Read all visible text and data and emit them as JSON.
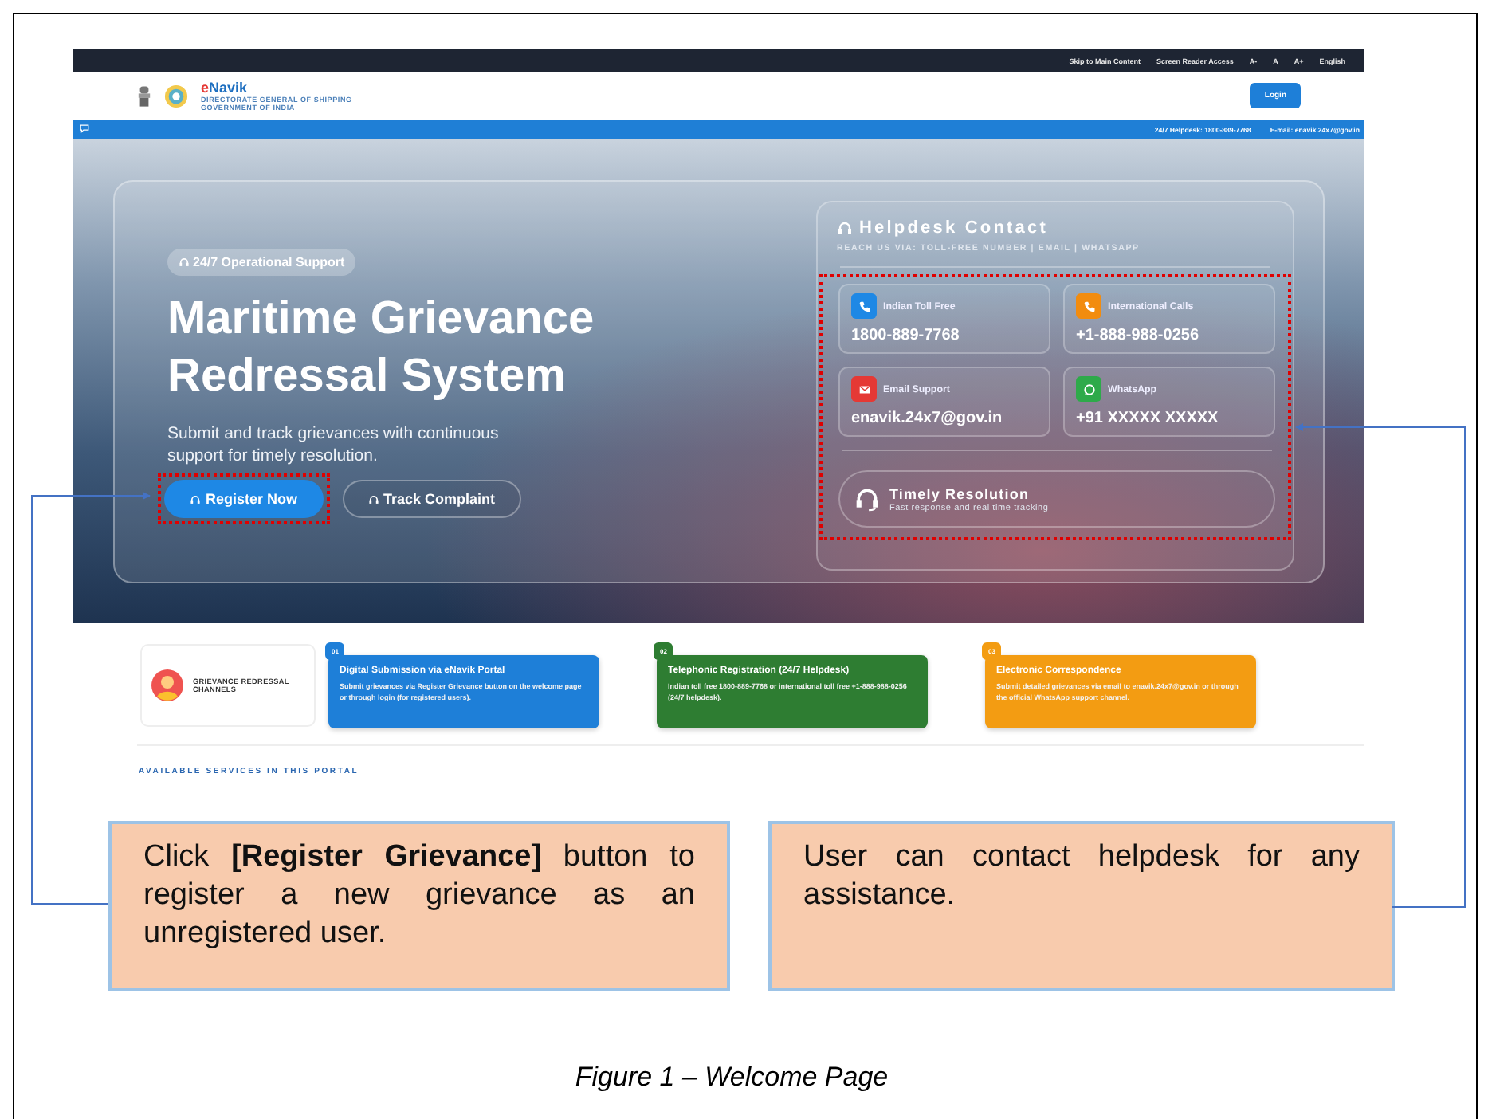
{
  "top_bar": {
    "links": [
      "Skip to Main Content",
      "Screen Reader Access",
      "A-",
      "A",
      "A+",
      "English"
    ]
  },
  "header": {
    "brand_initial": "e",
    "brand_rest": "Navik",
    "subtitle_lines": [
      "DIRECTORATE GENERAL OF SHIPPING",
      "GOVERNMENT OF INDIA"
    ],
    "login": "Login"
  },
  "info_bar": {
    "items": [
      "24/7 Helpdesk: 1800-889-7768",
      "E-mail: enavik.24x7@gov.in"
    ]
  },
  "hero": {
    "badge": "24/7 Operational Support",
    "title_lines": [
      "Maritime Grievance",
      "Redressal System"
    ],
    "description": "Submit and track grievances with continuous support for timely resolution.",
    "buttons": [
      {
        "label": "Register Now",
        "kind": "primary",
        "highlighted": true
      },
      {
        "label": "Track Complaint",
        "kind": "outline",
        "highlighted": false
      }
    ]
  },
  "helpdesk": {
    "title": "Helpdesk Contact",
    "subtitle": "REACH US VIA: TOLL-FREE NUMBER | EMAIL | WHATSAPP",
    "highlighted": true,
    "contacts": [
      {
        "label": "Indian Toll Free",
        "value": "1800-889-7768",
        "kind": "phone",
        "color": "#1e88e5"
      },
      {
        "label": "International Calls",
        "value": "+1-888-988-0256",
        "kind": "phone",
        "color": "#f28c0f"
      },
      {
        "label": "Email Support",
        "value": "enavik.24x7@gov.in",
        "kind": "mail",
        "color": "#e53935"
      },
      {
        "label": "WhatsApp",
        "value": "+91 XXXXX XXXXX",
        "kind": "chat",
        "color": "#2eaa4a"
      }
    ],
    "resolution": {
      "title": "Timely Resolution",
      "subtitle": "Fast response and real time tracking"
    }
  },
  "channels": {
    "heading_lines": [
      "GRIEVANCE REDRESSAL",
      "CHANNELS"
    ],
    "items": [
      {
        "number": "01",
        "title": "Digital Submission via eNavik Portal",
        "text": "Submit grievances via Register Grievance button on the welcome page or through login (for registered users).",
        "color": "#1e7fd8"
      },
      {
        "number": "02",
        "title": "Telephonic Registration (24/7 Helpdesk)",
        "text": "Indian toll free 1800-889-7768 or international toll free +1-888-988-0256 (24/7 helpdesk).",
        "color": "#2e7d32"
      },
      {
        "number": "03",
        "title": "Electronic Correspondence",
        "text": "Submit detailed grievances via email to enavik.24x7@gov.in or through the official WhatsApp support channel.",
        "color": "#f39c12"
      }
    ]
  },
  "section_heading": "AVAILABLE SERVICES IN THIS PORTAL",
  "callouts": [
    {
      "text": "Click **[Register Grievance]** button to register a new grievance as an unregistered user."
    },
    {
      "text": "User can contact helpdesk for any assistance."
    }
  ],
  "caption": "Figure 1 – Welcome Page"
}
